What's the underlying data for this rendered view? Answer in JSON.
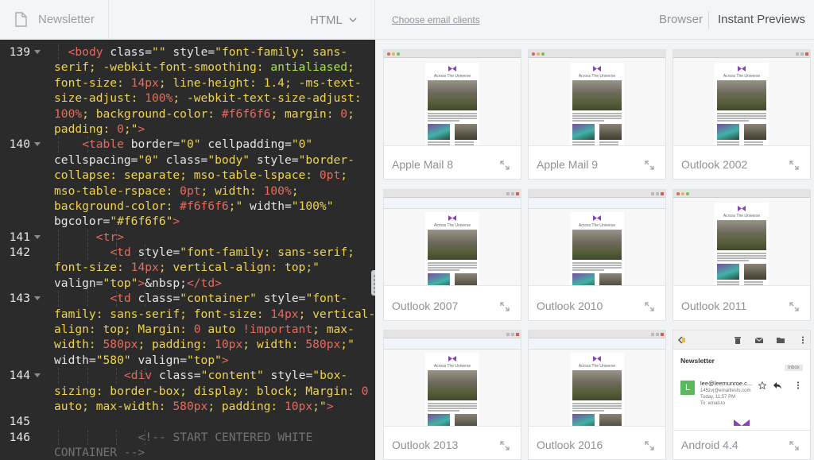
{
  "left_header": {
    "doc_title": "Newsletter",
    "mode": "HTML",
    "icons": {
      "document": "document-icon",
      "mode_chevron": "chevron-down-icon"
    }
  },
  "editor": {
    "lines": [
      {
        "num": "139",
        "fold": true,
        "indent": 1,
        "tokens": [
          [
            "t",
            "<body "
          ],
          [
            "a",
            "class"
          ],
          [
            "p",
            "="
          ],
          [
            "s",
            "\"\""
          ],
          [
            "p",
            " "
          ],
          [
            "a",
            "style"
          ],
          [
            "p",
            "="
          ],
          [
            "s",
            "\"font-family: sans-"
          ]
        ]
      },
      {
        "num": "",
        "fold": false,
        "indent": 0,
        "tokens": [
          [
            "s",
            "serif; -webkit-font-smoothing: "
          ],
          [
            "k",
            "antialiased"
          ],
          [
            "s",
            ";"
          ]
        ]
      },
      {
        "num": "",
        "fold": false,
        "indent": 0,
        "tokens": [
          [
            "s",
            "font-size: "
          ],
          [
            "t",
            "14px"
          ],
          [
            "s",
            "; line-height: 1.4; -ms-text-"
          ]
        ]
      },
      {
        "num": "",
        "fold": false,
        "indent": 0,
        "tokens": [
          [
            "s",
            "size-adjust: "
          ],
          [
            "t",
            "100%"
          ],
          [
            "s",
            "; -webkit-text-size-adjust:"
          ]
        ]
      },
      {
        "num": "",
        "fold": false,
        "indent": 0,
        "tokens": [
          [
            "t",
            "100%"
          ],
          [
            "s",
            "; background-color: "
          ],
          [
            "t",
            "#f6f6f6"
          ],
          [
            "s",
            "; margin: "
          ],
          [
            "t",
            "0"
          ],
          [
            "s",
            ";"
          ]
        ]
      },
      {
        "num": "",
        "fold": false,
        "indent": 0,
        "tokens": [
          [
            "s",
            "padding: "
          ],
          [
            "t",
            "0"
          ],
          [
            "s",
            ";\""
          ],
          [
            "t",
            ">"
          ]
        ]
      },
      {
        "num": "140",
        "fold": true,
        "indent": 2,
        "tokens": [
          [
            "t",
            "<table "
          ],
          [
            "a",
            "border"
          ],
          [
            "p",
            "="
          ],
          [
            "s",
            "\"0\""
          ],
          [
            "p",
            " "
          ],
          [
            "a",
            "cellpadding"
          ],
          [
            "p",
            "="
          ],
          [
            "s",
            "\"0\""
          ]
        ]
      },
      {
        "num": "",
        "fold": false,
        "indent": 0,
        "tokens": [
          [
            "a",
            "cellspacing"
          ],
          [
            "p",
            "="
          ],
          [
            "s",
            "\"0\""
          ],
          [
            "p",
            " "
          ],
          [
            "a",
            "class"
          ],
          [
            "p",
            "="
          ],
          [
            "s",
            "\"body\""
          ],
          [
            "p",
            " "
          ],
          [
            "a",
            "style"
          ],
          [
            "p",
            "="
          ],
          [
            "s",
            "\"border-"
          ]
        ]
      },
      {
        "num": "",
        "fold": false,
        "indent": 0,
        "tokens": [
          [
            "s",
            "collapse: separate; mso-table-lspace: "
          ],
          [
            "t",
            "0pt"
          ],
          [
            "s",
            ";"
          ]
        ]
      },
      {
        "num": "",
        "fold": false,
        "indent": 0,
        "tokens": [
          [
            "s",
            "mso-table-rspace: "
          ],
          [
            "t",
            "0pt"
          ],
          [
            "s",
            "; width: "
          ],
          [
            "t",
            "100%"
          ],
          [
            "s",
            ";"
          ]
        ]
      },
      {
        "num": "",
        "fold": false,
        "indent": 0,
        "tokens": [
          [
            "s",
            "background-color: "
          ],
          [
            "t",
            "#f6f6f6"
          ],
          [
            "s",
            ";\""
          ],
          [
            "p",
            " "
          ],
          [
            "a",
            "width"
          ],
          [
            "p",
            "="
          ],
          [
            "s",
            "\"100%\""
          ]
        ]
      },
      {
        "num": "",
        "fold": false,
        "indent": 0,
        "tokens": [
          [
            "a",
            "bgcolor"
          ],
          [
            "p",
            "="
          ],
          [
            "s",
            "\"#f6f6f6\""
          ],
          [
            "t",
            ">"
          ]
        ]
      },
      {
        "num": "141",
        "fold": true,
        "indent": 3,
        "tokens": [
          [
            "t",
            "<tr>"
          ]
        ]
      },
      {
        "num": "142",
        "fold": false,
        "indent": 4,
        "tokens": [
          [
            "t",
            "<td "
          ],
          [
            "a",
            "style"
          ],
          [
            "p",
            "="
          ],
          [
            "s",
            "\"font-family: sans-serif;"
          ]
        ]
      },
      {
        "num": "",
        "fold": false,
        "indent": 0,
        "tokens": [
          [
            "s",
            "font-size: "
          ],
          [
            "t",
            "14px"
          ],
          [
            "s",
            "; vertical-align: top;\""
          ]
        ]
      },
      {
        "num": "",
        "fold": false,
        "indent": 0,
        "tokens": [
          [
            "a",
            "valign"
          ],
          [
            "p",
            "="
          ],
          [
            "s",
            "\"top\""
          ],
          [
            "t",
            ">"
          ],
          [
            "p",
            "&nbsp;"
          ],
          [
            "t",
            "</td>"
          ]
        ]
      },
      {
        "num": "143",
        "fold": true,
        "indent": 4,
        "tokens": [
          [
            "t",
            "<td "
          ],
          [
            "a",
            "class"
          ],
          [
            "p",
            "="
          ],
          [
            "s",
            "\"container\""
          ],
          [
            "p",
            " "
          ],
          [
            "a",
            "style"
          ],
          [
            "p",
            "="
          ],
          [
            "s",
            "\"font-"
          ]
        ]
      },
      {
        "num": "",
        "fold": false,
        "indent": 0,
        "tokens": [
          [
            "s",
            "family: sans-serif; font-size: "
          ],
          [
            "t",
            "14px"
          ],
          [
            "s",
            "; vertical-"
          ]
        ]
      },
      {
        "num": "",
        "fold": false,
        "indent": 0,
        "tokens": [
          [
            "s",
            "align: top; Margin: "
          ],
          [
            "t",
            "0"
          ],
          [
            "s",
            " auto "
          ],
          [
            "t",
            "!important"
          ],
          [
            "s",
            "; max-"
          ]
        ]
      },
      {
        "num": "",
        "fold": false,
        "indent": 0,
        "tokens": [
          [
            "s",
            "width: "
          ],
          [
            "t",
            "580px"
          ],
          [
            "s",
            "; padding: "
          ],
          [
            "t",
            "10px"
          ],
          [
            "s",
            "; width: "
          ],
          [
            "t",
            "580px"
          ],
          [
            "s",
            ";\""
          ]
        ]
      },
      {
        "num": "",
        "fold": false,
        "indent": 0,
        "tokens": [
          [
            "a",
            "width"
          ],
          [
            "p",
            "="
          ],
          [
            "s",
            "\"580\""
          ],
          [
            "p",
            " "
          ],
          [
            "a",
            "valign"
          ],
          [
            "p",
            "="
          ],
          [
            "s",
            "\"top\""
          ],
          [
            "t",
            ">"
          ]
        ]
      },
      {
        "num": "144",
        "fold": true,
        "indent": 5,
        "tokens": [
          [
            "t",
            "<div "
          ],
          [
            "a",
            "class"
          ],
          [
            "p",
            "="
          ],
          [
            "s",
            "\"content\""
          ],
          [
            "p",
            " "
          ],
          [
            "a",
            "style"
          ],
          [
            "p",
            "="
          ],
          [
            "s",
            "\"box-"
          ]
        ]
      },
      {
        "num": "",
        "fold": false,
        "indent": 0,
        "tokens": [
          [
            "s",
            "sizing: border-box; display: block; Margin: "
          ],
          [
            "t",
            "0"
          ]
        ]
      },
      {
        "num": "",
        "fold": false,
        "indent": 0,
        "tokens": [
          [
            "s",
            "auto; max-width: "
          ],
          [
            "t",
            "580px"
          ],
          [
            "s",
            "; padding: "
          ],
          [
            "t",
            "10px"
          ],
          [
            "s",
            ";\""
          ],
          [
            "t",
            ">"
          ]
        ]
      },
      {
        "num": "145",
        "fold": false,
        "indent": 0,
        "tokens": []
      },
      {
        "num": "146",
        "fold": false,
        "indent": 6,
        "tokens": [
          [
            "c",
            "<!-- START CENTERED WHITE"
          ]
        ]
      },
      {
        "num": "",
        "fold": false,
        "indent": 0,
        "tokens": [
          [
            "c",
            "CONTAINER -->"
          ]
        ]
      }
    ]
  },
  "right_header": {
    "choose_link": "Choose email clients",
    "tabs": {
      "browser": "Browser",
      "instant": "Instant Previews"
    }
  },
  "previews": [
    {
      "name": "Apple Mail 8",
      "kind": "mac"
    },
    {
      "name": "Apple Mail 9",
      "kind": "mac"
    },
    {
      "name": "Outlook 2002",
      "kind": "win"
    },
    {
      "name": "Outlook 2007",
      "kind": "ribbon"
    },
    {
      "name": "Outlook 2010",
      "kind": "ribbon"
    },
    {
      "name": "Outlook 2011",
      "kind": "mac"
    },
    {
      "name": "Outlook 2013",
      "kind": "ribbon"
    },
    {
      "name": "Outlook 2016",
      "kind": "ribbon"
    },
    {
      "name": "Android 4.4",
      "kind": "android"
    }
  ],
  "mini_email": {
    "title": "Across The Universe"
  },
  "android": {
    "subject": "Newsletter",
    "folder": "Inbox",
    "avatar_letter": "L",
    "from": "lee@leemunroe.c...",
    "meta_1": "145zvj@emailtests.com",
    "meta_2": "Today, 11:57 PM",
    "meta_3": "To: email-to"
  },
  "colors": {
    "brand_purple": "#8b3fb8",
    "editor_bg": "#2b2b2b"
  }
}
